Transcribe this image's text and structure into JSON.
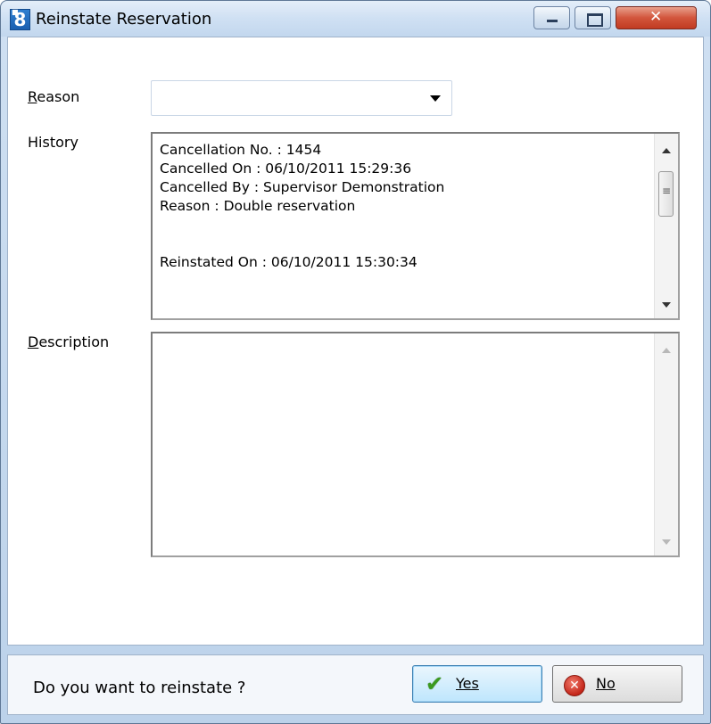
{
  "window": {
    "title": "Reinstate Reservation",
    "icon": "app-8-icon",
    "icon_text": "8"
  },
  "form": {
    "reason_label": "Reason",
    "reason_value": "",
    "history_label": "History",
    "history_lines": [
      "Cancellation No. : 1454",
      "Cancelled On : 06/10/2011 15:29:36",
      "Cancelled By : Supervisor Demonstration",
      "Reason : Double reservation",
      "",
      "",
      "Reinstated On : 06/10/2011 15:30:34"
    ],
    "description_label": "Description",
    "description_value": ""
  },
  "footer": {
    "question": "Do you want to reinstate ?",
    "yes_label": "Yes",
    "no_label": "No"
  },
  "colors": {
    "accent": "#3c7fb1",
    "close": "#c13b22",
    "yes_icon": "#3b9a1f",
    "no_icon": "#c4261a"
  }
}
